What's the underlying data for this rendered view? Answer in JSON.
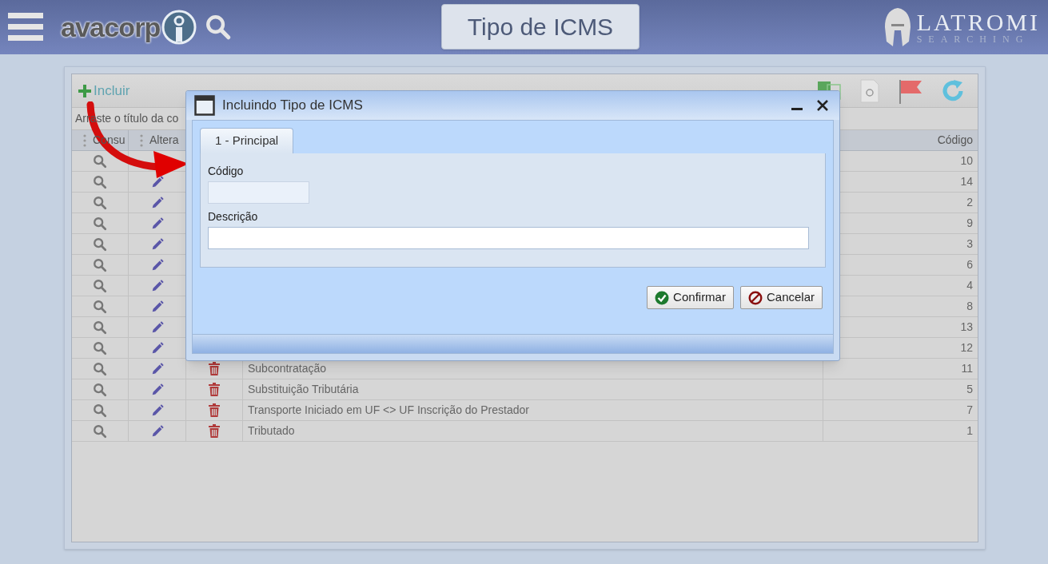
{
  "header": {
    "logo_text": "avacorp",
    "page_title": "Tipo de ICMS",
    "brand_name": "LATROMI",
    "brand_tagline": "SEARCHING"
  },
  "toolbar": {
    "add_label": "Incluir"
  },
  "group_hint": "Arraste o título da co",
  "columns": {
    "consult": "Consu",
    "edit": "Altera",
    "code": "Código"
  },
  "rows": [
    {
      "code": "10",
      "edit_icon_visible": false
    },
    {
      "code": "14",
      "edit_icon_visible": true
    },
    {
      "code": "2",
      "edit_icon_visible": true
    },
    {
      "code": "9",
      "edit_icon_visible": true
    },
    {
      "code": "3",
      "edit_icon_visible": true
    },
    {
      "code": "6",
      "edit_icon_visible": true
    },
    {
      "code": "4",
      "edit_icon_visible": true
    },
    {
      "code": "8",
      "edit_icon_visible": true
    },
    {
      "code": "13",
      "edit_icon_visible": true
    },
    {
      "code": "12",
      "edit_icon_visible": true
    },
    {
      "description": "Subcontratação",
      "code": "11",
      "edit_icon_visible": true
    },
    {
      "description": "Substituição Tributária",
      "code": "5",
      "edit_icon_visible": true
    },
    {
      "description": "Transporte Iniciado em UF <> UF Inscrição do Prestador",
      "code": "7",
      "edit_icon_visible": true
    },
    {
      "description": "Tributado",
      "code": "1",
      "edit_icon_visible": true
    }
  ],
  "dialog": {
    "title": "Incluindo Tipo de ICMS",
    "tabs": [
      {
        "label": "1 - Principal",
        "selected": true
      }
    ],
    "fields": [
      {
        "label": "Código",
        "disabled": true
      },
      {
        "label": "Descrição",
        "disabled": false
      }
    ],
    "buttons": [
      {
        "label": "Confirmar",
        "kind": "confirm"
      },
      {
        "label": "Cancelar",
        "kind": "cancel"
      }
    ]
  }
}
